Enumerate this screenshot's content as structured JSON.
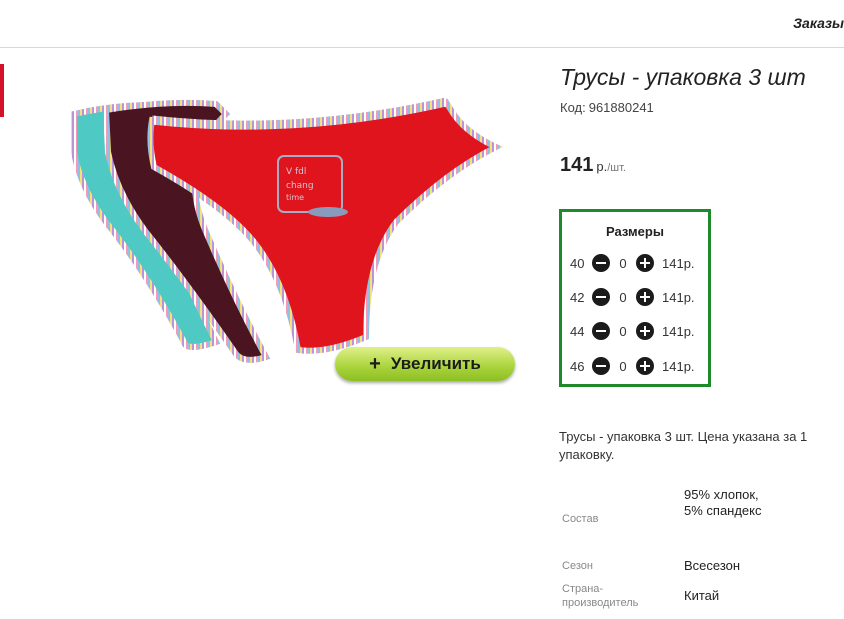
{
  "header": {
    "orders_label": "Заказы"
  },
  "product": {
    "title": "Трусы - упаковка 3 шт",
    "code_label": "Код:",
    "code": "961880241",
    "price": "141",
    "currency": "р.",
    "unit": "/шт.",
    "zoom_button": {
      "icon": "plus-icon",
      "label": "Увеличить"
    },
    "sizes": {
      "title": "Размеры",
      "rows": [
        {
          "size": "40",
          "qty": "0",
          "price": "141р."
        },
        {
          "size": "42",
          "qty": "0",
          "price": "141р."
        },
        {
          "size": "44",
          "qty": "0",
          "price": "141р."
        },
        {
          "size": "46",
          "qty": "0",
          "price": "141р."
        }
      ]
    },
    "description": "Трусы - упаковка 3 шт. Цена указана за 1 упаковку.",
    "specs": [
      {
        "key": "Состав",
        "value": "95% хлопок, 5% спандекс"
      },
      {
        "key": "Сезон",
        "value": "Всесезон"
      },
      {
        "key": "Страна-производитель",
        "value": "Китай"
      }
    ]
  },
  "colors": {
    "accent_red": "#d3122a",
    "sizes_border": "#1f8a2a",
    "zoom_button": "#a9d33a",
    "panty_red": "#e0141c",
    "panty_maroon": "#4a1420",
    "panty_teal": "#4ec9c4"
  }
}
